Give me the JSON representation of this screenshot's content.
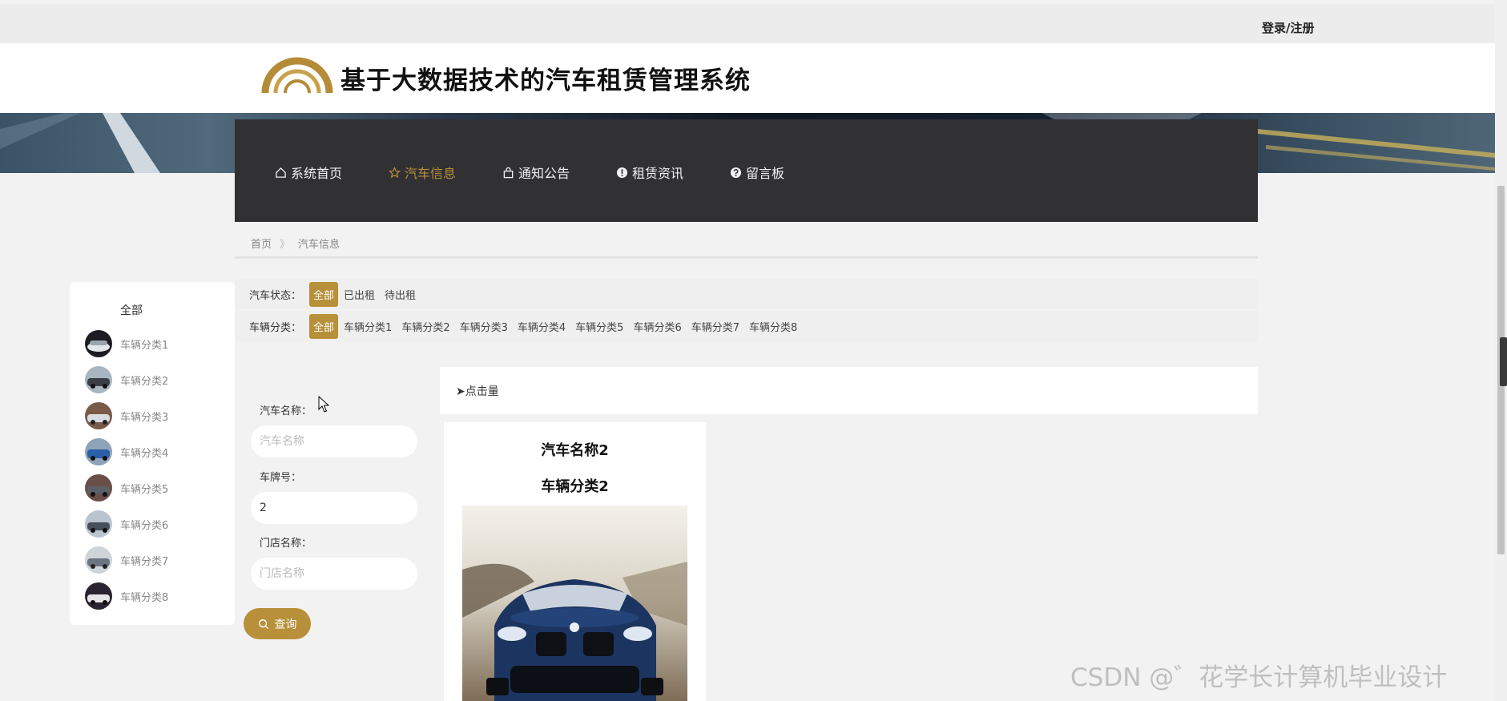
{
  "top_bar": {
    "login_register": "登录/注册"
  },
  "header": {
    "site_title": "基于大数据技术的汽车租赁管理系统"
  },
  "nav": {
    "items": [
      {
        "label": "系统首页",
        "icon": "home-icon"
      },
      {
        "label": "汽车信息",
        "icon": "star-icon",
        "active": true
      },
      {
        "label": "通知公告",
        "icon": "bag-icon"
      },
      {
        "label": "租赁资讯",
        "icon": "exclamation-icon"
      },
      {
        "label": "留言板",
        "icon": "question-icon"
      }
    ]
  },
  "breadcrumb": {
    "home": "首页",
    "separator": "》",
    "current": "汽车信息"
  },
  "category_sidebar": {
    "all_label": "全部",
    "items": [
      "车辆分类1",
      "车辆分类2",
      "车辆分类3",
      "车辆分类4",
      "车辆分类5",
      "车辆分类6",
      "车辆分类7",
      "车辆分类8"
    ]
  },
  "filters": {
    "status": {
      "label": "汽车状态：",
      "options": [
        "全部",
        "已出租",
        "待出租"
      ],
      "selected": "全部"
    },
    "category": {
      "label": "车辆分类：",
      "options": [
        "全部",
        "车辆分类1",
        "车辆分类2",
        "车辆分类3",
        "车辆分类4",
        "车辆分类5",
        "车辆分类6",
        "车辆分类7",
        "车辆分类8"
      ],
      "selected": "全部"
    }
  },
  "search_form": {
    "car_name": {
      "label": "汽车名称：",
      "placeholder": "汽车名称",
      "value": ""
    },
    "plate_number": {
      "label": "车牌号：",
      "placeholder": "",
      "value": "2"
    },
    "store_name": {
      "label": "门店名称：",
      "placeholder": "门店名称",
      "value": ""
    },
    "search_button": "查询"
  },
  "sort": {
    "arrow": "➤",
    "label": "点击量"
  },
  "results": [
    {
      "name": "汽车名称2",
      "category": "车辆分类2"
    }
  ],
  "watermark": "CSDN @゛花学长计算机毕业设计",
  "colors": {
    "accent": "#b8903a",
    "nav_bg": "#313033",
    "page_bg": "#f2f2f2"
  }
}
